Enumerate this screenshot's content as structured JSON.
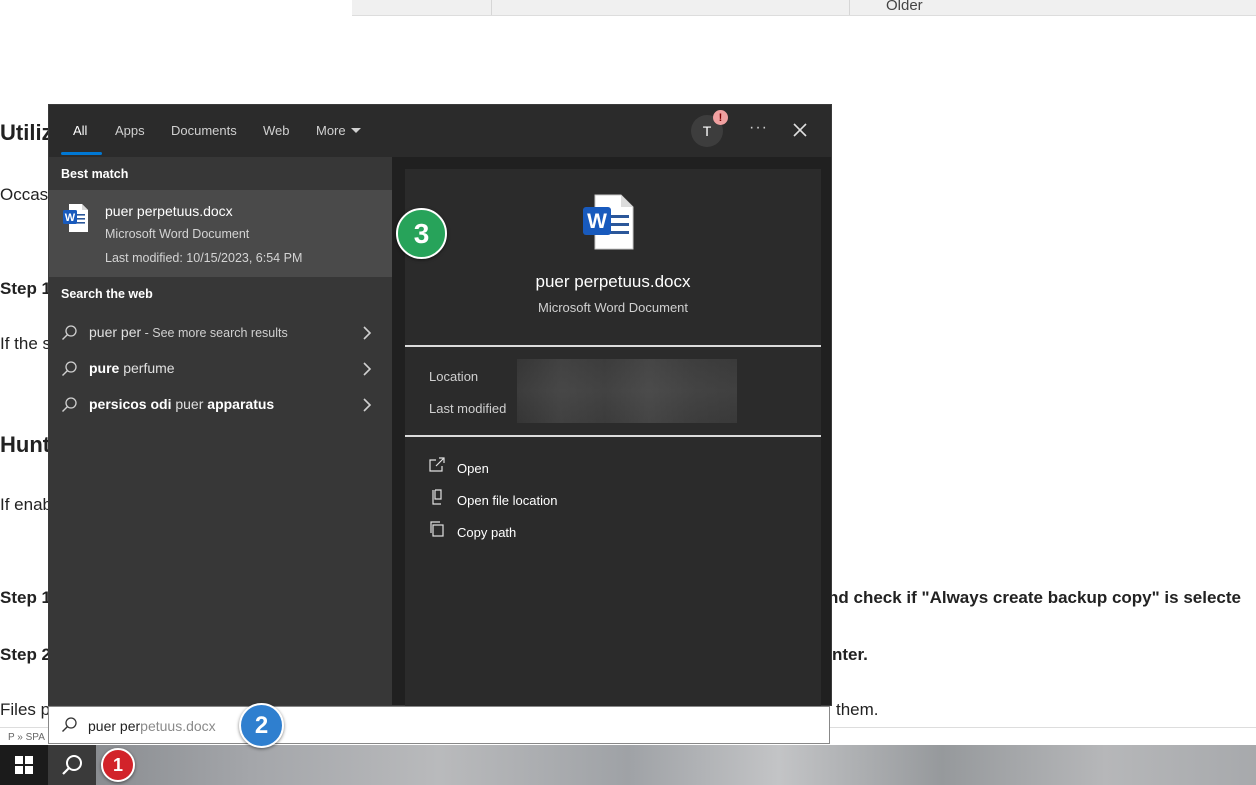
{
  "document": {
    "older_label": "Older",
    "heading_1": "Utiliz",
    "para_1": "Occas",
    "step_a": "Step 1",
    "para_2": "If the s",
    "heading_2": "Hunt",
    "para_3": "If enab",
    "step_b": "Step 1",
    "step_b_right": "nd check if \"Always create backup copy\" is selecte",
    "step_c": "Step 2",
    "step_c_right": "nter.",
    "para_4": "Files p",
    "para_4_right": "them.",
    "status_path": "P » SPA"
  },
  "search": {
    "tabs": [
      "All",
      "Apps",
      "Documents",
      "Web",
      "More"
    ],
    "avatar_letter": "T",
    "avatar_badge": "!",
    "more_options": "···",
    "best_match_label": "Best match",
    "best_match": {
      "title_bold": "puer per",
      "title_rest": "petuus.docx",
      "type": "Microsoft Word Document",
      "modified": "Last modified: 10/15/2023, 6:54 PM"
    },
    "web_label": "Search the web",
    "web_results": [
      {
        "pre": "puer per",
        "bold": "",
        "post": "",
        "suffix": " - See more search results"
      },
      {
        "pre": "",
        "bold": "pure",
        "post": " perfume",
        "suffix": ""
      },
      {
        "pre": "",
        "bold": "persicos odi",
        "post": " puer ",
        "tail_bold": "apparatus",
        "suffix": ""
      }
    ],
    "preview": {
      "title": "puer perpetuus.docx",
      "type": "Microsoft Word Document",
      "location_label": "Location",
      "modified_label": "Last modified",
      "actions": [
        "Open",
        "Open file location",
        "Copy path"
      ]
    },
    "query_typed": "puer per",
    "query_ghost": "petuus.docx"
  },
  "callouts": [
    "1",
    "2",
    "3"
  ],
  "colors": {
    "accent": "#0078d4",
    "word_blue": "#185abd",
    "callout_red": "#d2232a",
    "callout_blue": "#2f7fcf",
    "callout_green": "#27a35a"
  }
}
